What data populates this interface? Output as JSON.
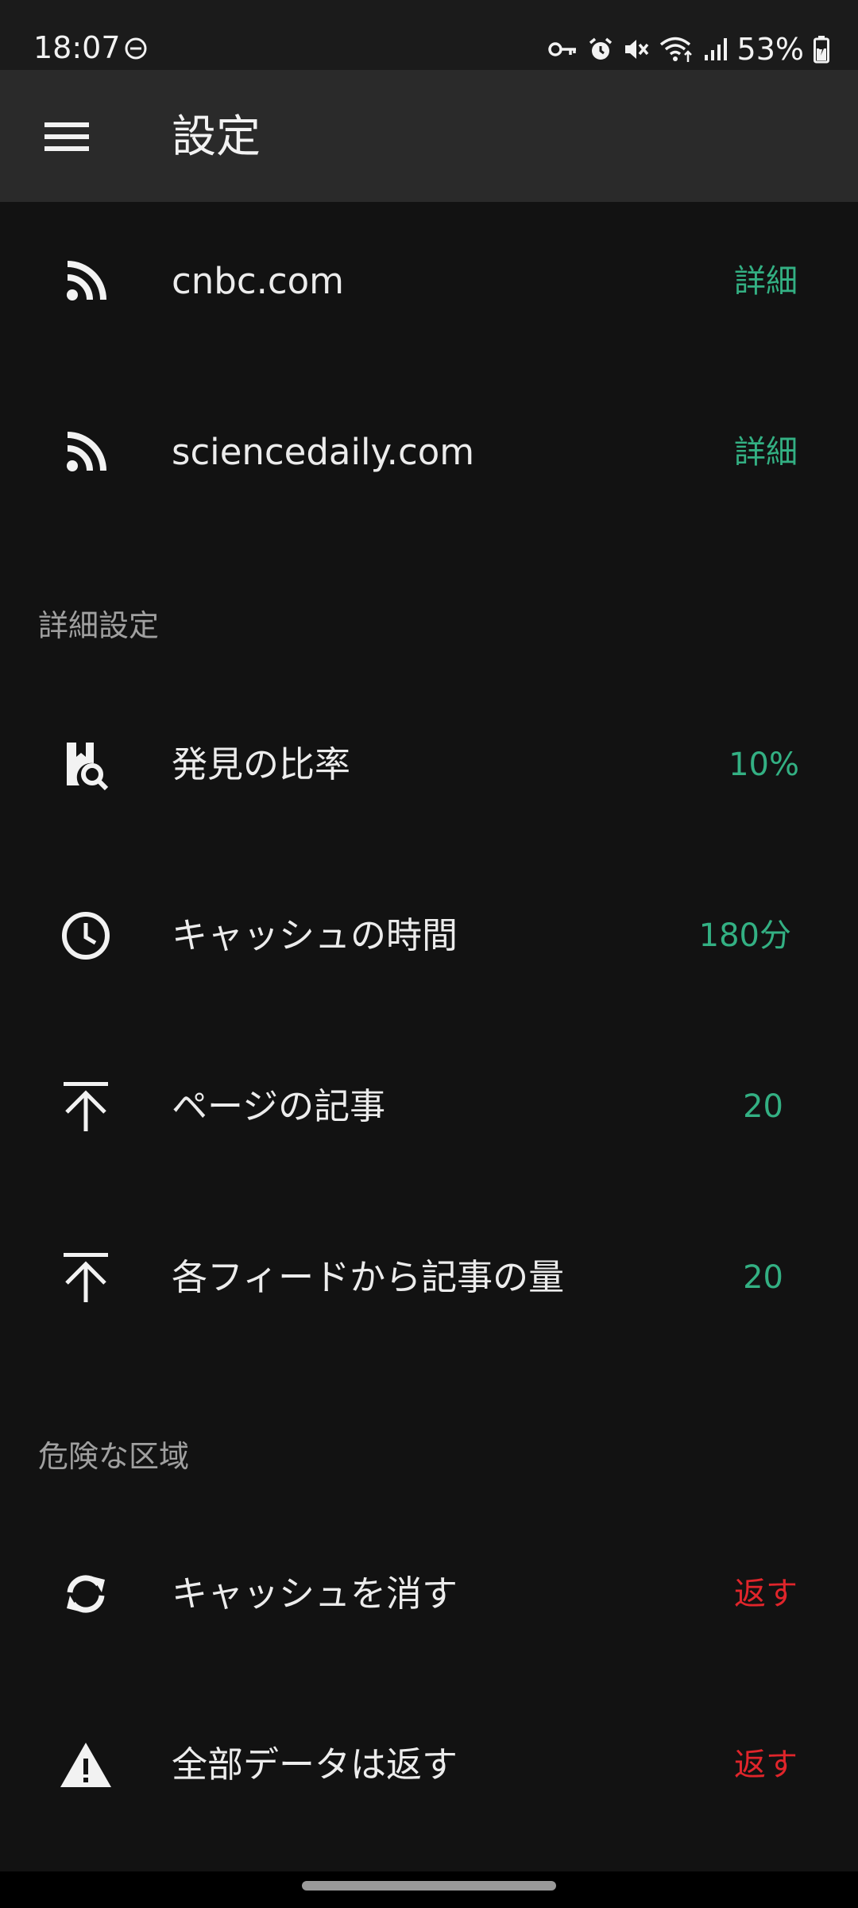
{
  "status_bar": {
    "time": "18:07",
    "battery": "53%",
    "icons": [
      "do-not-disturb-icon",
      "vpn-key-icon",
      "alarm-icon",
      "mute-icon",
      "wifi-icon",
      "signal-icon",
      "battery-icon"
    ]
  },
  "app_bar": {
    "title": "設定",
    "menu_icon": "hamburger-menu-icon"
  },
  "feeds": [
    {
      "icon": "rss-icon",
      "label": "cnbc.com",
      "action": "詳細"
    },
    {
      "icon": "rss-icon",
      "label": "sciencedaily.com",
      "action": "詳細"
    }
  ],
  "advanced": {
    "header": "詳細設定",
    "items": [
      {
        "icon": "discovery-search-icon",
        "label": "発見の比率",
        "value": "10%"
      },
      {
        "icon": "clock-icon",
        "label": "キャッシュの時間",
        "value": "180分"
      },
      {
        "icon": "arrow-up-bar-icon",
        "label": "ページの記事",
        "value": "20"
      },
      {
        "icon": "arrow-up-bar-icon",
        "label": "各フィードから記事の量",
        "value": "20"
      }
    ]
  },
  "danger": {
    "header": "危険な区域",
    "items": [
      {
        "icon": "sync-icon",
        "label": "キャッシュを消す",
        "action": "返す"
      },
      {
        "icon": "warning-icon",
        "label": "全部データは返す",
        "action": "返す"
      }
    ]
  },
  "colors": {
    "accent": "#33b083",
    "danger": "#e0252b",
    "background": "#121212",
    "app_bar": "#2a2a2a"
  }
}
